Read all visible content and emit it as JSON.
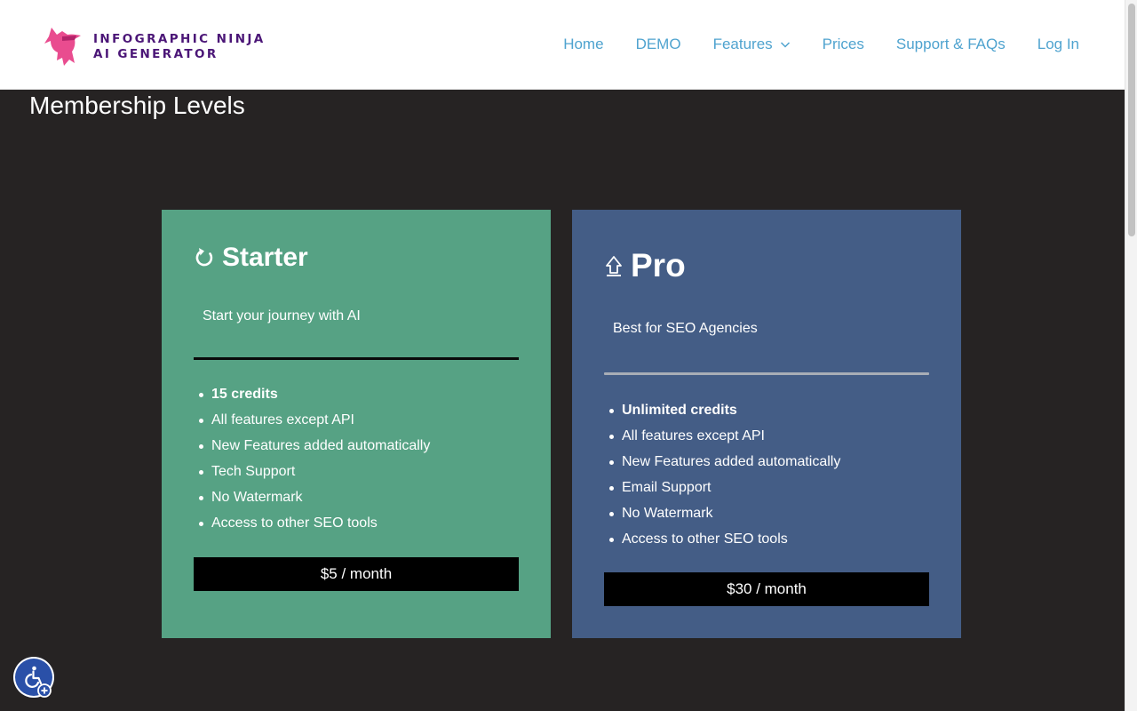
{
  "brand": {
    "line1": "INFOGRAPHIC NINJA",
    "line2": "AI GENERATOR",
    "accent": "#4b1677",
    "logo_color": "#e94c8f"
  },
  "nav": {
    "items": [
      "Home",
      "DEMO",
      "Features",
      "Prices",
      "Support & FAQs",
      "Log In"
    ],
    "link_color": "#4fa3cf"
  },
  "page": {
    "title": "Membership Levels",
    "background": "#262323"
  },
  "plans": [
    {
      "name": "Starter",
      "icon": "refresh-icon",
      "tagline": "Start your journey with AI",
      "features": [
        "15 credits",
        "All features except API",
        "New Features added automatically",
        "Tech Support",
        "No Watermark",
        "Access to other SEO tools"
      ],
      "price": "$5 / month",
      "color": "#56a284"
    },
    {
      "name": "Pro",
      "icon": "upgrade-arrow-icon",
      "tagline": "Best for SEO Agencies",
      "features": [
        "Unlimited credits",
        "All features except API",
        "New Features added automatically",
        "Email Support",
        "No Watermark",
        "Access to other SEO tools"
      ],
      "price": "$30 / month",
      "color": "#445d86"
    }
  ],
  "accessibility": {
    "icon": "wheelchair-icon",
    "color": "#2a50a8"
  }
}
